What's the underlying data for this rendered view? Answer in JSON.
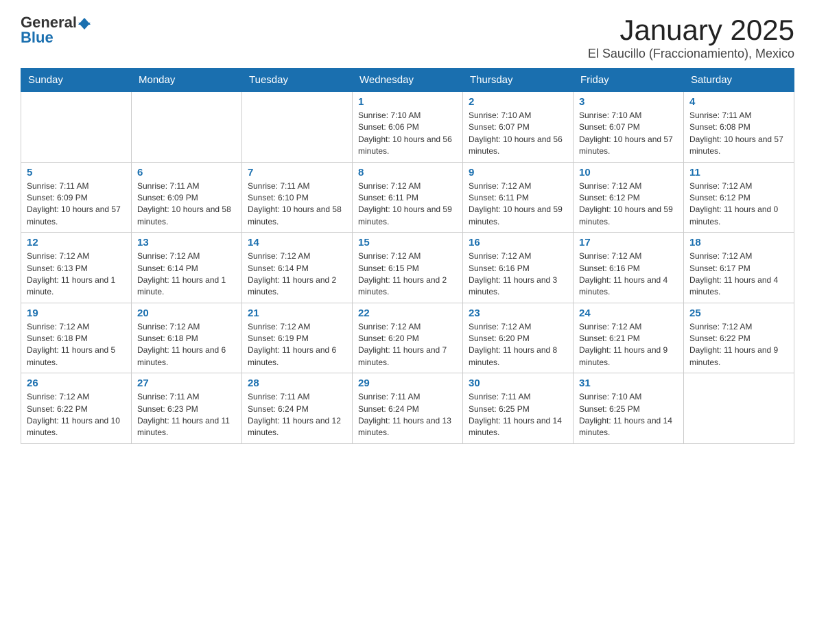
{
  "logo": {
    "general": "General",
    "blue": "Blue"
  },
  "title": "January 2025",
  "subtitle": "El Saucillo (Fraccionamiento), Mexico",
  "days_of_week": [
    "Sunday",
    "Monday",
    "Tuesday",
    "Wednesday",
    "Thursday",
    "Friday",
    "Saturday"
  ],
  "weeks": [
    [
      {
        "day": "",
        "info": ""
      },
      {
        "day": "",
        "info": ""
      },
      {
        "day": "",
        "info": ""
      },
      {
        "day": "1",
        "info": "Sunrise: 7:10 AM\nSunset: 6:06 PM\nDaylight: 10 hours and 56 minutes."
      },
      {
        "day": "2",
        "info": "Sunrise: 7:10 AM\nSunset: 6:07 PM\nDaylight: 10 hours and 56 minutes."
      },
      {
        "day": "3",
        "info": "Sunrise: 7:10 AM\nSunset: 6:07 PM\nDaylight: 10 hours and 57 minutes."
      },
      {
        "day": "4",
        "info": "Sunrise: 7:11 AM\nSunset: 6:08 PM\nDaylight: 10 hours and 57 minutes."
      }
    ],
    [
      {
        "day": "5",
        "info": "Sunrise: 7:11 AM\nSunset: 6:09 PM\nDaylight: 10 hours and 57 minutes."
      },
      {
        "day": "6",
        "info": "Sunrise: 7:11 AM\nSunset: 6:09 PM\nDaylight: 10 hours and 58 minutes."
      },
      {
        "day": "7",
        "info": "Sunrise: 7:11 AM\nSunset: 6:10 PM\nDaylight: 10 hours and 58 minutes."
      },
      {
        "day": "8",
        "info": "Sunrise: 7:12 AM\nSunset: 6:11 PM\nDaylight: 10 hours and 59 minutes."
      },
      {
        "day": "9",
        "info": "Sunrise: 7:12 AM\nSunset: 6:11 PM\nDaylight: 10 hours and 59 minutes."
      },
      {
        "day": "10",
        "info": "Sunrise: 7:12 AM\nSunset: 6:12 PM\nDaylight: 10 hours and 59 minutes."
      },
      {
        "day": "11",
        "info": "Sunrise: 7:12 AM\nSunset: 6:12 PM\nDaylight: 11 hours and 0 minutes."
      }
    ],
    [
      {
        "day": "12",
        "info": "Sunrise: 7:12 AM\nSunset: 6:13 PM\nDaylight: 11 hours and 1 minute."
      },
      {
        "day": "13",
        "info": "Sunrise: 7:12 AM\nSunset: 6:14 PM\nDaylight: 11 hours and 1 minute."
      },
      {
        "day": "14",
        "info": "Sunrise: 7:12 AM\nSunset: 6:14 PM\nDaylight: 11 hours and 2 minutes."
      },
      {
        "day": "15",
        "info": "Sunrise: 7:12 AM\nSunset: 6:15 PM\nDaylight: 11 hours and 2 minutes."
      },
      {
        "day": "16",
        "info": "Sunrise: 7:12 AM\nSunset: 6:16 PM\nDaylight: 11 hours and 3 minutes."
      },
      {
        "day": "17",
        "info": "Sunrise: 7:12 AM\nSunset: 6:16 PM\nDaylight: 11 hours and 4 minutes."
      },
      {
        "day": "18",
        "info": "Sunrise: 7:12 AM\nSunset: 6:17 PM\nDaylight: 11 hours and 4 minutes."
      }
    ],
    [
      {
        "day": "19",
        "info": "Sunrise: 7:12 AM\nSunset: 6:18 PM\nDaylight: 11 hours and 5 minutes."
      },
      {
        "day": "20",
        "info": "Sunrise: 7:12 AM\nSunset: 6:18 PM\nDaylight: 11 hours and 6 minutes."
      },
      {
        "day": "21",
        "info": "Sunrise: 7:12 AM\nSunset: 6:19 PM\nDaylight: 11 hours and 6 minutes."
      },
      {
        "day": "22",
        "info": "Sunrise: 7:12 AM\nSunset: 6:20 PM\nDaylight: 11 hours and 7 minutes."
      },
      {
        "day": "23",
        "info": "Sunrise: 7:12 AM\nSunset: 6:20 PM\nDaylight: 11 hours and 8 minutes."
      },
      {
        "day": "24",
        "info": "Sunrise: 7:12 AM\nSunset: 6:21 PM\nDaylight: 11 hours and 9 minutes."
      },
      {
        "day": "25",
        "info": "Sunrise: 7:12 AM\nSunset: 6:22 PM\nDaylight: 11 hours and 9 minutes."
      }
    ],
    [
      {
        "day": "26",
        "info": "Sunrise: 7:12 AM\nSunset: 6:22 PM\nDaylight: 11 hours and 10 minutes."
      },
      {
        "day": "27",
        "info": "Sunrise: 7:11 AM\nSunset: 6:23 PM\nDaylight: 11 hours and 11 minutes."
      },
      {
        "day": "28",
        "info": "Sunrise: 7:11 AM\nSunset: 6:24 PM\nDaylight: 11 hours and 12 minutes."
      },
      {
        "day": "29",
        "info": "Sunrise: 7:11 AM\nSunset: 6:24 PM\nDaylight: 11 hours and 13 minutes."
      },
      {
        "day": "30",
        "info": "Sunrise: 7:11 AM\nSunset: 6:25 PM\nDaylight: 11 hours and 14 minutes."
      },
      {
        "day": "31",
        "info": "Sunrise: 7:10 AM\nSunset: 6:25 PM\nDaylight: 11 hours and 14 minutes."
      },
      {
        "day": "",
        "info": ""
      }
    ]
  ]
}
